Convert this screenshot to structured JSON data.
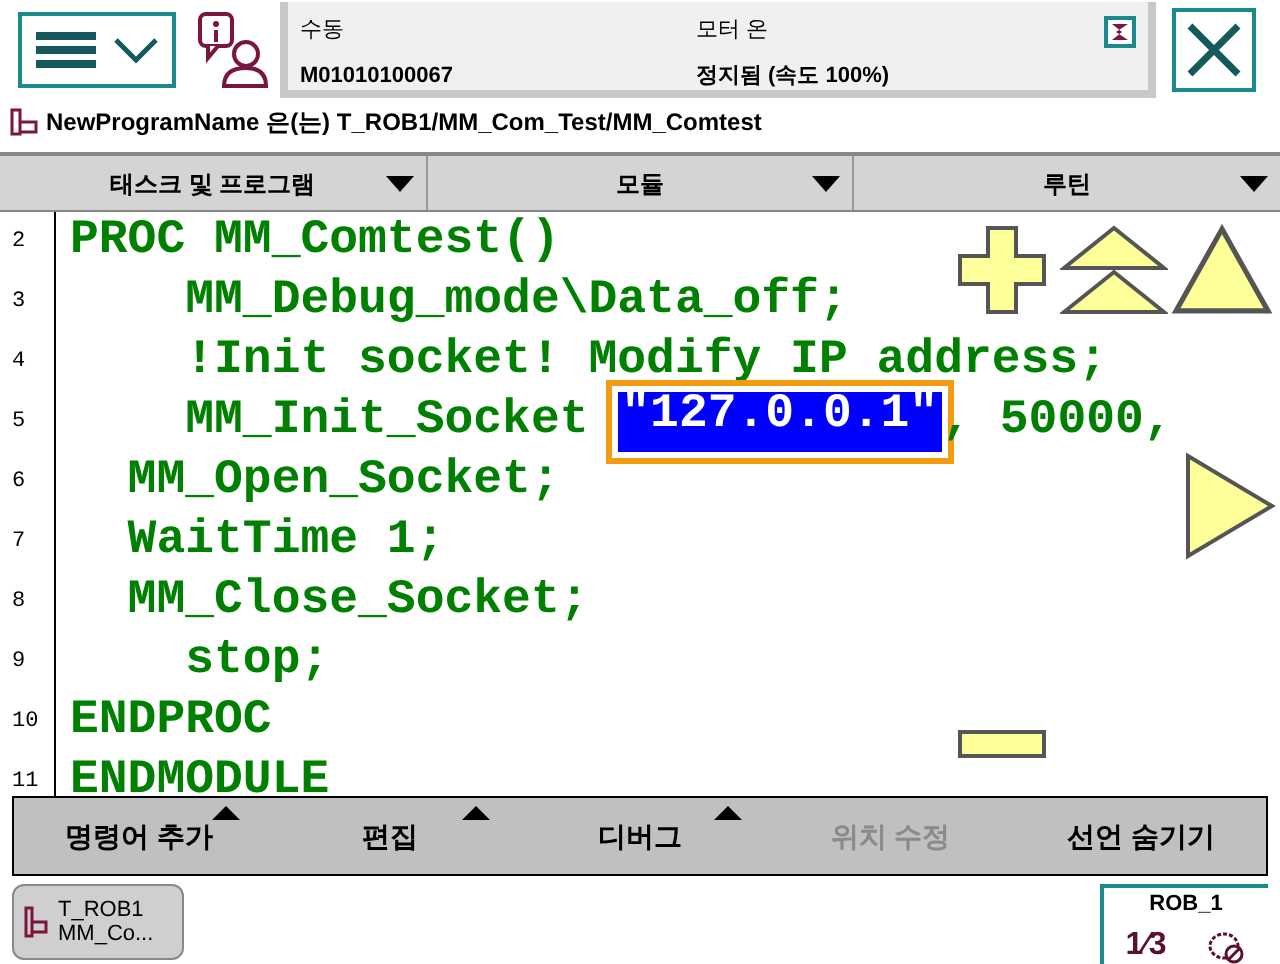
{
  "header": {
    "mode": "수동",
    "controller": "M01010100067",
    "motor": "모터 온",
    "state": "정지됨 (속도 100%)"
  },
  "path": {
    "program": "NewProgramName",
    "relation": "은(는)",
    "location": "T_ROB1/MM_Com_Test/MM_Comtest"
  },
  "selectors": [
    {
      "label": "태스크 및 프로그램"
    },
    {
      "label": "모듈"
    },
    {
      "label": "루틴"
    }
  ],
  "code_lines": [
    {
      "number": "2",
      "segments": [
        {
          "kind": "plain",
          "text": "PROC MM_Comtest()"
        }
      ]
    },
    {
      "number": "3",
      "segments": [
        {
          "kind": "plain",
          "text": "    MM_Debug_mode\\Data_off;"
        }
      ]
    },
    {
      "number": "4",
      "segments": [
        {
          "kind": "plain",
          "text": "    !Init socket! Modify IP address;"
        }
      ]
    },
    {
      "number": "5",
      "segments": [
        {
          "kind": "plain",
          "text": "    MM_Init_Socket "
        },
        {
          "kind": "selected",
          "text": "\"127.0.0.1\""
        },
        {
          "kind": "plain",
          "text": ", 50000, "
        }
      ]
    },
    {
      "number": "6",
      "segments": [
        {
          "kind": "plain",
          "text": "  MM_Open_Socket;"
        }
      ]
    },
    {
      "number": "7",
      "segments": [
        {
          "kind": "plain",
          "text": "  WaitTime 1;"
        }
      ]
    },
    {
      "number": "8",
      "segments": [
        {
          "kind": "plain",
          "text": "  MM_Close_Socket;"
        }
      ]
    },
    {
      "number": "9",
      "segments": [
        {
          "kind": "plain",
          "text": "    stop;"
        }
      ]
    },
    {
      "number": "10",
      "segments": [
        {
          "kind": "plain",
          "text": "ENDPROC"
        }
      ]
    },
    {
      "number": "11",
      "segments": [
        {
          "kind": "plain",
          "text": "ENDMODULE"
        }
      ]
    }
  ],
  "toolbar": [
    {
      "label": "명령어 추가",
      "menu": true,
      "disabled": false
    },
    {
      "label": "편집",
      "menu": true,
      "disabled": false
    },
    {
      "label": "디버그",
      "menu": true,
      "disabled": false
    },
    {
      "label": "위치 수정",
      "menu": false,
      "disabled": true
    },
    {
      "label": "선언 숨기기",
      "menu": false,
      "disabled": false
    }
  ],
  "taskbar": [
    {
      "line1": "T_ROB1",
      "line2": "MM_Co..."
    }
  ],
  "status": {
    "unit": "ROB_1",
    "increment": "1⁄3"
  }
}
